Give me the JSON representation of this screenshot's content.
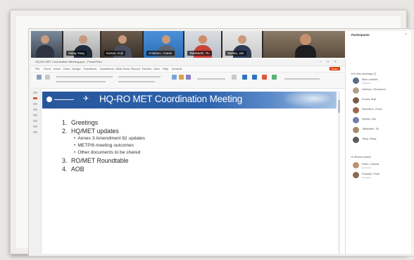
{
  "video_tiles": [
    {
      "name": ""
    },
    {
      "name": "Xiang Yang"
    },
    {
      "name": "Kumar, Anjli"
    },
    {
      "name": "Cristiano, Ciaran"
    },
    {
      "name": "Takahashi, Tiu"
    },
    {
      "name": "Spinka, Jan"
    },
    {
      "name": ""
    }
  ],
  "powerpoint": {
    "window_title": "HQ-RO MET Coordination Meeting.pptx - PowerPoint",
    "menu": [
      "File",
      "Home",
      "Insert",
      "Draw",
      "Design",
      "Transitions",
      "Animations",
      "Slide Show",
      "Record",
      "Review",
      "View",
      "Help",
      "Acrobat"
    ],
    "share_label": "Share",
    "slide": {
      "title": "HQ-RO MET Coordination Meeting",
      "agenda": [
        {
          "num": "1.",
          "text": "Greetings",
          "sub": []
        },
        {
          "num": "2.",
          "text": "HQ/MET updates",
          "sub": [
            "Annex 3 Amendment 82 updates",
            "METP/6 meeting outcomes",
            "Other documents to be shared"
          ]
        },
        {
          "num": "3.",
          "text": "RO/MET Roundtable",
          "sub": []
        },
        {
          "num": "4.",
          "text": "AOB",
          "sub": []
        }
      ]
    }
  },
  "participants": {
    "title": "Participants",
    "sections": [
      {
        "label": "In this meeting (7)",
        "people": [
          {
            "name": "Mira Loeblich",
            "role": "Organizer",
            "color": "#5a6b8c"
          },
          {
            "name": "Harrison, Richmond",
            "role": "",
            "color": "#b0a08a"
          },
          {
            "name": "Kumar, Anjli",
            "role": "",
            "color": "#7a5a48"
          },
          {
            "name": "Nicholson, Chloe",
            "role": "",
            "color": "#9a6a4a"
          },
          {
            "name": "Spinka, Jan",
            "role": "",
            "color": "#6e7fa8"
          },
          {
            "name": "Takahashi, Tiu",
            "role": "",
            "color": "#a88a6a"
          },
          {
            "name": "Yang, Xiang",
            "role": "",
            "color": "#5b5b5b"
          }
        ]
      },
      {
        "label": "Others invited",
        "people": [
          {
            "name": "Keller, Joanna",
            "role": "Accepted",
            "color": "#c0906a"
          },
          {
            "name": "Rudolph, Peter",
            "role": "Accepted",
            "color": "#8a6a52"
          }
        ]
      }
    ]
  }
}
